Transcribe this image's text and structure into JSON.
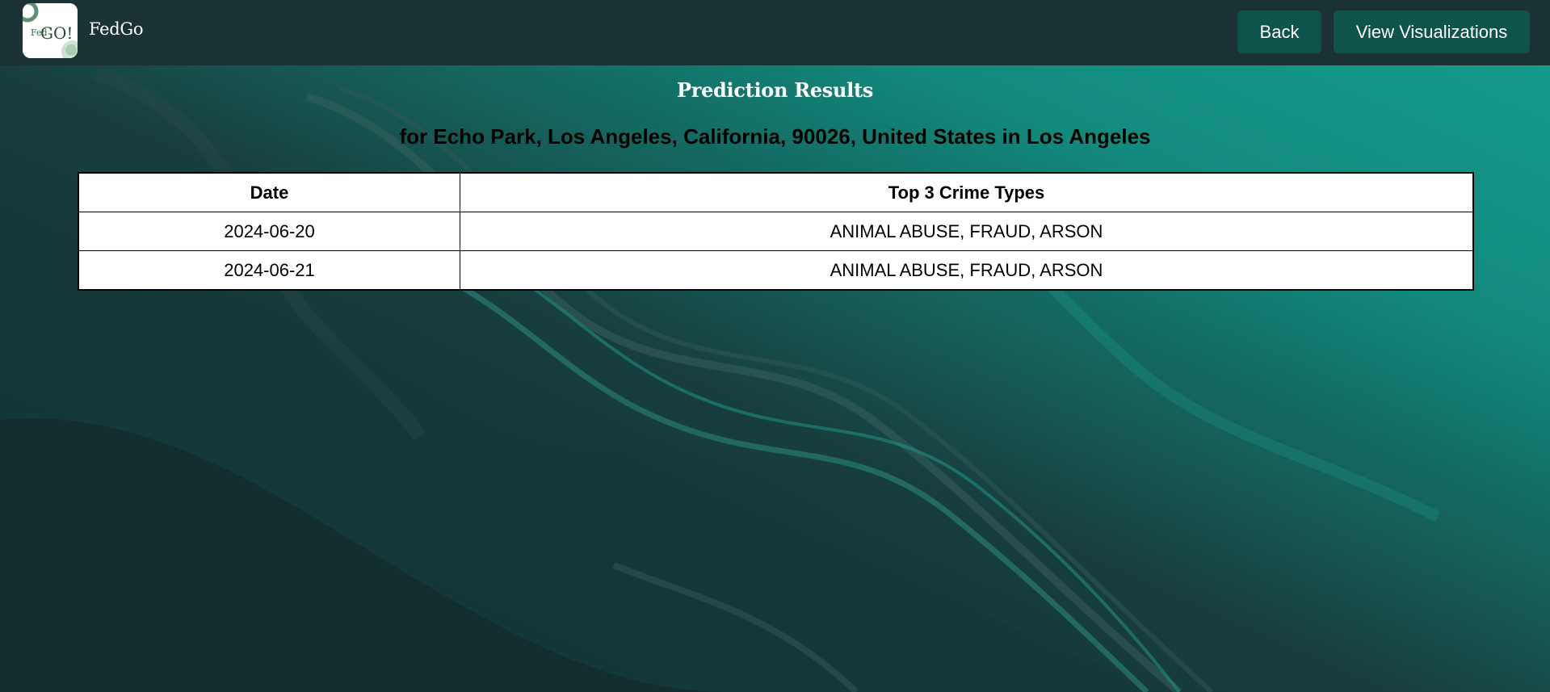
{
  "app": {
    "brand": "FedGo",
    "logo_text": "FedGO!"
  },
  "nav": {
    "back_label": "Back",
    "visualizations_label": "View Visualizations"
  },
  "main": {
    "title": "Prediction Results",
    "subtitle": "for Echo Park, Los Angeles, California, 90026, United States in Los Angeles",
    "table": {
      "headers": [
        "Date",
        "Top 3 Crime Types"
      ],
      "rows": [
        [
          "2024-06-20",
          "ANIMAL ABUSE, FRAUD, ARSON"
        ],
        [
          "2024-06-21",
          "ANIMAL ABUSE, FRAUD, ARSON"
        ]
      ]
    }
  },
  "colors": {
    "navbar": "#1c3335",
    "button": "#0f544b",
    "accent": "#13998a",
    "dark": "#14302f"
  }
}
